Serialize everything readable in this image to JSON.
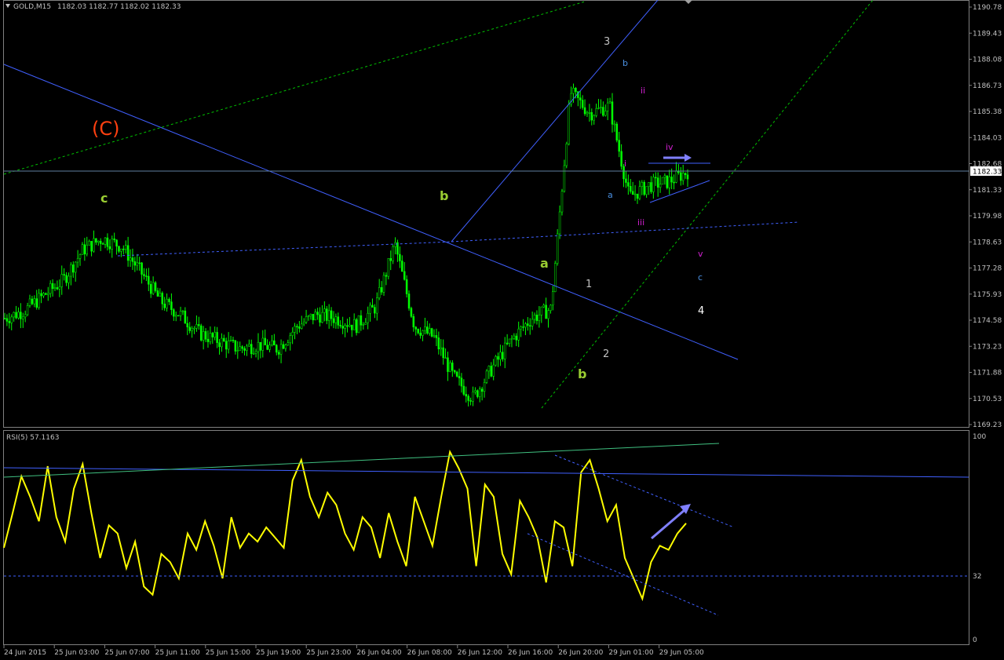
{
  "header": {
    "symbol": "GOLD,M15",
    "ohlc": "1182.03 1182.77 1182.02 1182.33",
    "dropdown_icon": "triangle-down-icon"
  },
  "colors": {
    "background": "#000000",
    "candle": "#00ff00",
    "rsi_line": "#ffff00",
    "trendline": "#4060ff",
    "channel_dotted": "#00c000",
    "axis_text": "#c0c0c0",
    "current_price_bg": "#ffffff"
  },
  "chart_data": [
    {
      "type": "candlestick",
      "title": "GOLD,M15",
      "price_axis_ticks": [
        "1190.78",
        "1189.43",
        "1188.08",
        "1186.73",
        "1185.38",
        "1184.03",
        "1182.68",
        "1181.33",
        "1179.98",
        "1178.63",
        "1177.28",
        "1175.93",
        "1174.58",
        "1173.23",
        "1171.88",
        "1170.53",
        "1169.23"
      ],
      "ylim": [
        1169.0,
        1191.0
      ],
      "current_price": "1182.33",
      "x_ticks": [
        "24 Jun 2015",
        "25 Jun 03:00",
        "25 Jun 07:00",
        "25 Jun 11:00",
        "25 Jun 15:00",
        "25 Jun 19:00",
        "25 Jun 23:00",
        "26 Jun 04:00",
        "26 Jun 08:00",
        "26 Jun 12:00",
        "26 Jun 16:00",
        "26 Jun 20:00",
        "29 Jun 01:00",
        "29 Jun 05:00"
      ],
      "close_path": [
        [
          "24 Jun 2015",
          1174.6
        ],
        [
          "25 Jun 01:00",
          1175.0
        ],
        [
          "25 Jun 02:00",
          1175.8
        ],
        [
          "25 Jun 03:00",
          1176.6
        ],
        [
          "25 Jun 05:00",
          1178.2
        ],
        [
          "25 Jun 06:00",
          1178.8
        ],
        [
          "25 Jun 07:00",
          1178.4
        ],
        [
          "25 Jun 08:00",
          1177.0
        ],
        [
          "25 Jun 10:00",
          1175.5
        ],
        [
          "25 Jun 11:00",
          1174.8
        ],
        [
          "25 Jun 13:00",
          1173.8
        ],
        [
          "25 Jun 15:00",
          1173.4
        ],
        [
          "25 Jun 17:00",
          1173.0
        ],
        [
          "25 Jun 19:00",
          1173.2
        ],
        [
          "25 Jun 21:00",
          1173.0
        ],
        [
          "25 Jun 23:00",
          1174.2
        ],
        [
          "26 Jun 01:00",
          1174.8
        ],
        [
          "26 Jun 04:00",
          1174.6
        ],
        [
          "26 Jun 06:00",
          1174.2
        ],
        [
          "26 Jun 08:00",
          1175.2
        ],
        [
          "26 Jun 09:00",
          1178.5
        ],
        [
          "26 Jun 10:00",
          1174.2
        ],
        [
          "26 Jun 12:00",
          1173.6
        ],
        [
          "26 Jun 14:00",
          1171.5
        ],
        [
          "26 Jun 15:00",
          1170.4
        ],
        [
          "26 Jun 16:00",
          1172.0
        ],
        [
          "26 Jun 18:00",
          1173.5
        ],
        [
          "26 Jun 20:00",
          1174.6
        ],
        [
          "26 Jun 22:00",
          1175.1
        ],
        [
          "29 Jun 00:00",
          1186.5
        ],
        [
          "29 Jun 01:00",
          1185.4
        ],
        [
          "29 Jun 02:00",
          1185.8
        ],
        [
          "29 Jun 03:00",
          1181.0
        ],
        [
          "29 Jun 04:00",
          1181.6
        ],
        [
          "29 Jun 05:00",
          1181.8
        ],
        [
          "29 Jun 06:00",
          1182.33
        ]
      ],
      "wave_labels": [
        {
          "text": "(C)",
          "color": "#ff4010"
        },
        {
          "text": "c",
          "color": "#9acd32"
        },
        {
          "text": "b",
          "color": "#9acd32"
        },
        {
          "text": "a",
          "color": "#9acd32"
        },
        {
          "text": "b",
          "color": "#9acd32"
        },
        {
          "text": "3",
          "color": "#c0c0c0"
        },
        {
          "text": "1",
          "color": "#c0c0c0"
        },
        {
          "text": "2",
          "color": "#c0c0c0"
        },
        {
          "text": "4",
          "color": "#ffffff"
        },
        {
          "text": "b",
          "color": "#4a90e2"
        },
        {
          "text": "a",
          "color": "#4a90e2"
        },
        {
          "text": "c",
          "color": "#4a90e2"
        },
        {
          "text": "ii",
          "color": "#d020d0"
        },
        {
          "text": "i",
          "color": "#d020d0"
        },
        {
          "text": "iii",
          "color": "#d020d0"
        },
        {
          "text": "iv",
          "color": "#d020d0"
        },
        {
          "text": "v",
          "color": "#d020d0"
        }
      ]
    },
    {
      "type": "line",
      "title": "RSI(5) 57.1163",
      "series": [
        {
          "name": "RSI(5)",
          "values": [
            45,
            62,
            80,
            70,
            58,
            85,
            60,
            48,
            74,
            86,
            62,
            40,
            56,
            52,
            35,
            48,
            26,
            22,
            42,
            38,
            30,
            52,
            44,
            58,
            46,
            30,
            60,
            45,
            52,
            48,
            55,
            50,
            45,
            78,
            88,
            70,
            60,
            72,
            66,
            52,
            44,
            60,
            55,
            40,
            62,
            48,
            36,
            70,
            58,
            46,
            70,
            92,
            84,
            74,
            36,
            76,
            70,
            42,
            32,
            68,
            60,
            50,
            28,
            58,
            55,
            36,
            82,
            88,
            74,
            58,
            66,
            40,
            30,
            20,
            38,
            46,
            44,
            52,
            57
          ]
        }
      ],
      "ylim": [
        0,
        100
      ],
      "y_ticks": [
        "100",
        "32",
        "0"
      ],
      "levels": [
        32
      ]
    }
  ]
}
